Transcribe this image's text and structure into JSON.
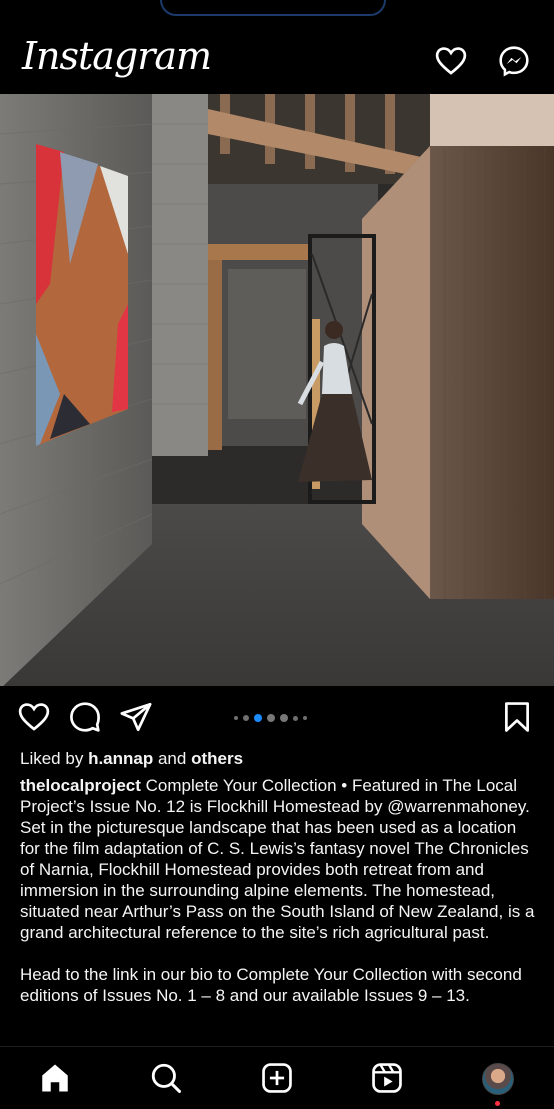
{
  "header": {
    "app_title": "Instagram",
    "icons": [
      "heart-icon",
      "messenger-icon"
    ]
  },
  "post": {
    "carousel": {
      "total": 6,
      "current": 3
    },
    "likes": {
      "prefix": "Liked by",
      "user": "h.annap",
      "joiner": "and",
      "others": "others"
    },
    "caption": {
      "username": "thelocalproject",
      "text": "Complete Your Collection • Featured in The Local Project’s Issue No. 12 is Flockhill Homestead by @warrenmahoney. Set in the picturesque landscape that has been used as a location for the film adaptation of C. S. Lewis’s fantasy novel The Chronicles of Narnia, Flockhill Homestead provides both retreat from and immersion in the surrounding alpine elements. The homestead, situated near Arthur’s Pass on the South Island of New Zealand, is a grand architectural reference to the site’s rich agricultural past.",
      "more": "Head to the link in our bio to Complete Your Collection with second editions of Issues No. 1 – 8 and our available Issues 9 – 13."
    },
    "action_icons": [
      "heart-icon",
      "comment-icon",
      "share-icon",
      "bookmark-icon"
    ]
  },
  "bottom_nav": {
    "items": [
      "home-icon",
      "search-icon",
      "create-icon",
      "reels-icon",
      "profile-avatar"
    ],
    "notification_color": "#ff3040"
  },
  "colors": {
    "background": "#000000",
    "text": "#f5f5f5",
    "active_dot": "#1a8cff"
  }
}
